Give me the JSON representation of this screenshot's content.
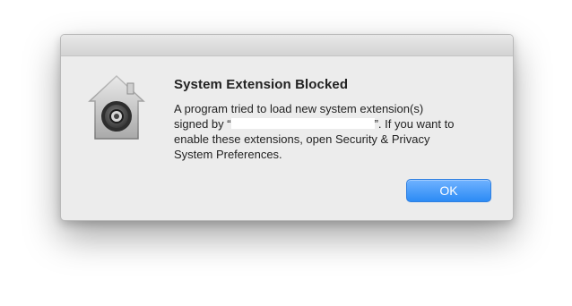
{
  "dialog": {
    "title": "System Extension Blocked",
    "message_line1": "A program tried to load new system extension(s)",
    "message_line2_prefix": "signed by “",
    "message_line2_suffix": "”.  If you want to",
    "message_line3": "enable these extensions, open Security & Privacy",
    "message_line4": "System Preferences.",
    "ok_label": "OK",
    "icon": "security-house-lock-icon"
  },
  "colors": {
    "window_bg": "#ececec",
    "button_blue": "#3a93f7",
    "text": "#222222"
  }
}
